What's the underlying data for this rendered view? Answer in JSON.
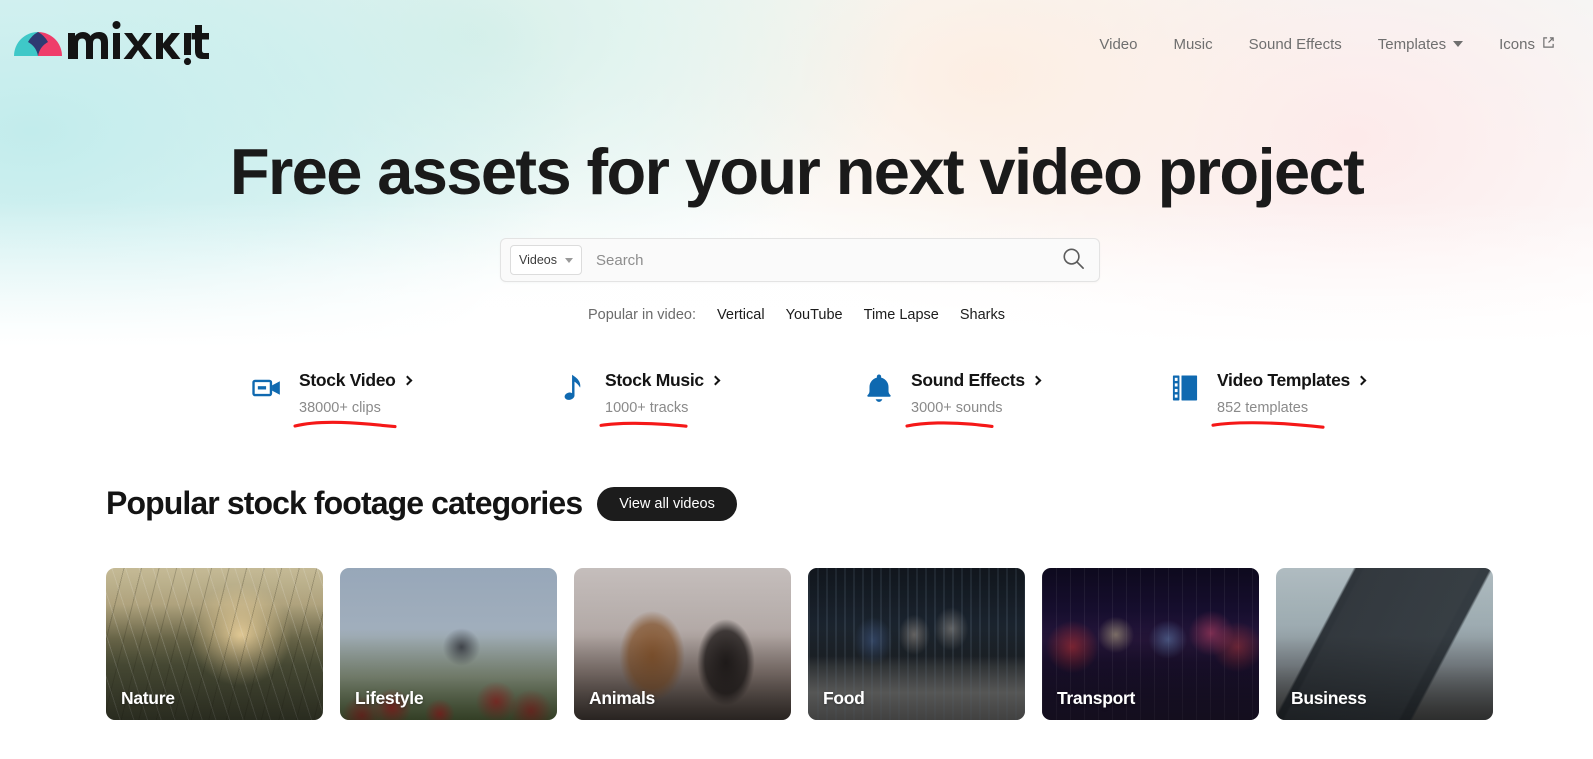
{
  "site": {
    "brand": "mixkit",
    "logo_colors": {
      "teal": "#3fc8c8",
      "pink": "#ef3d6a",
      "navy": "#2f3a72"
    }
  },
  "nav": {
    "items": [
      {
        "label": "Video",
        "icon": "",
        "has_caret": false,
        "external": false
      },
      {
        "label": "Music",
        "icon": "",
        "has_caret": false,
        "external": false
      },
      {
        "label": "Sound Effects",
        "icon": "",
        "has_caret": false,
        "external": false
      },
      {
        "label": "Templates",
        "icon": "chevron-down-icon",
        "has_caret": true,
        "external": false
      },
      {
        "label": "Icons",
        "icon": "external-link-icon",
        "has_caret": false,
        "external": true
      }
    ]
  },
  "hero": {
    "title": "Free assets for your next video project"
  },
  "search": {
    "scope_value": "Videos",
    "placeholder": "Search",
    "value": "",
    "submit_icon": "search-icon"
  },
  "popular": {
    "label": "Popular in video:",
    "tags": [
      "Vertical",
      "YouTube",
      "Time Lapse",
      "Sharks"
    ]
  },
  "quicklinks": {
    "accent_color": "#0f69b0",
    "annotation_color": "#f51818",
    "items": [
      {
        "title": "Stock Video",
        "count": "38000+ clips",
        "icon": "video-camera-icon",
        "underline": true
      },
      {
        "title": "Stock Music",
        "count": "1000+ tracks",
        "icon": "music-note-icon",
        "underline": true
      },
      {
        "title": "Sound Effects",
        "count": "3000+ sounds",
        "icon": "bell-icon",
        "underline": true
      },
      {
        "title": "Video Templates",
        "count": "852 templates",
        "icon": "film-strip-icon",
        "underline": true
      }
    ]
  },
  "section": {
    "title": "Popular stock footage categories",
    "button_label": "View all videos"
  },
  "categories": {
    "cards": [
      {
        "label": "Nature",
        "image_class": "img-nature"
      },
      {
        "label": "Lifestyle",
        "image_class": "img-lifestyle"
      },
      {
        "label": "Animals",
        "image_class": "img-animals"
      },
      {
        "label": "Food",
        "image_class": "img-food"
      },
      {
        "label": "Transport",
        "image_class": "img-transport"
      },
      {
        "label": "Business",
        "image_class": "img-business"
      }
    ]
  }
}
